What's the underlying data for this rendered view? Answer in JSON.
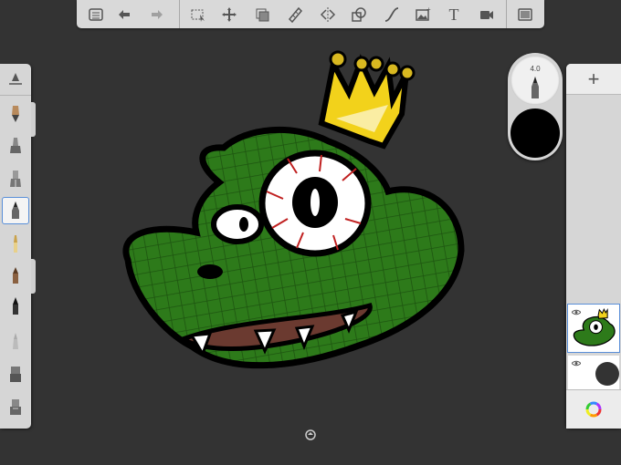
{
  "toolbar": {
    "icons": [
      "list-icon",
      "undo-icon",
      "redo-icon",
      "selection-icon",
      "transform-icon",
      "layer-edit-icon",
      "ruler-icon",
      "symmetry-icon",
      "shape-icon",
      "curve-icon",
      "image-icon",
      "text-icon",
      "video-icon",
      "fullscreen-icon"
    ],
    "text_label": "T"
  },
  "brushes": {
    "items": [
      "lasso-fill",
      "pencil",
      "marker",
      "ballpoint",
      "airbrush",
      "paintbrush",
      "brush-dark",
      "fine-pen",
      "soft-brush",
      "eraser",
      "smudge"
    ],
    "selected_index": 3
  },
  "puck": {
    "size_label": "4.0",
    "color": "#000000"
  },
  "layers": {
    "add_label": "+",
    "background_color": "#333333"
  },
  "colors": {
    "ui_gray": "#d6d6d6",
    "accent": "#5a8fd8",
    "canvas": "#333333",
    "croc_green": "#2d7a1a",
    "crown_yellow": "#f2d21b"
  }
}
